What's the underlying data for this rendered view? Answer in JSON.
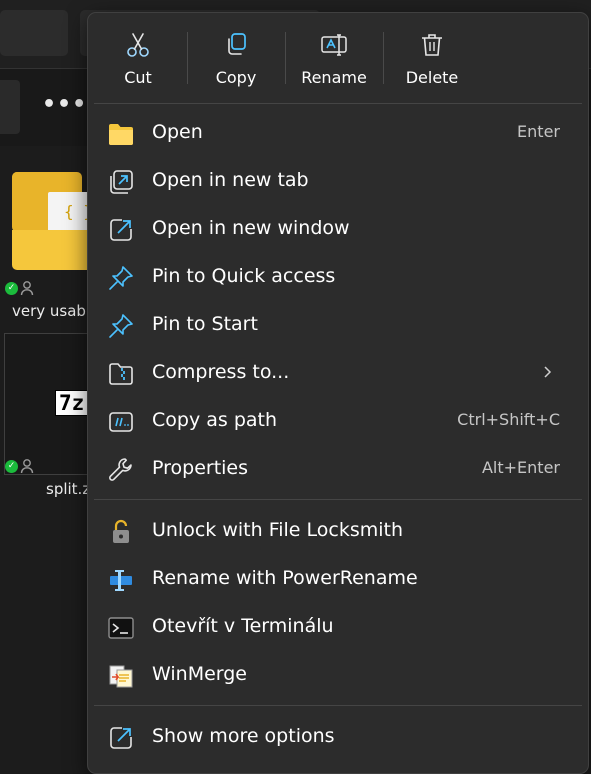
{
  "background": {
    "folder_name": "very usab",
    "zip_name": "split.z",
    "zip_badge": "7z",
    "more_icon": "more-dots-icon"
  },
  "quick_actions": [
    {
      "label": "Cut",
      "icon": "scissors-icon"
    },
    {
      "label": "Copy",
      "icon": "copy-icon"
    },
    {
      "label": "Rename",
      "icon": "rename-icon"
    },
    {
      "label": "Delete",
      "icon": "trash-icon"
    }
  ],
  "menu": {
    "primary": [
      {
        "label": "Open",
        "shortcut": "Enter",
        "icon": "folder-icon"
      },
      {
        "label": "Open in new tab",
        "shortcut": "",
        "icon": "new-tab-icon"
      },
      {
        "label": "Open in new window",
        "shortcut": "",
        "icon": "new-window-icon"
      },
      {
        "label": "Pin to Quick access",
        "shortcut": "",
        "icon": "pin-icon"
      },
      {
        "label": "Pin to Start",
        "shortcut": "",
        "icon": "pin-icon"
      },
      {
        "label": "Compress to...",
        "shortcut": "",
        "icon": "zip-folder-icon",
        "submenu": true
      },
      {
        "label": "Copy as path",
        "shortcut": "Ctrl+Shift+C",
        "icon": "copy-path-icon"
      },
      {
        "label": "Properties",
        "shortcut": "Alt+Enter",
        "icon": "wrench-icon"
      }
    ],
    "extensions": [
      {
        "label": "Unlock with File Locksmith",
        "icon": "padlock-icon"
      },
      {
        "label": "Rename with PowerRename",
        "icon": "powerrename-icon"
      },
      {
        "label": "Otevřít v Terminálu",
        "icon": "terminal-icon"
      },
      {
        "label": "WinMerge",
        "icon": "winmerge-icon"
      }
    ],
    "more": {
      "label": "Show more options",
      "icon": "show-more-icon"
    }
  },
  "colors": {
    "menu_bg": "#2c2c2c",
    "accent_blue": "#4cc2ff",
    "folder_yellow": "#f5c73c",
    "sync_green": "#1bbb3c"
  }
}
